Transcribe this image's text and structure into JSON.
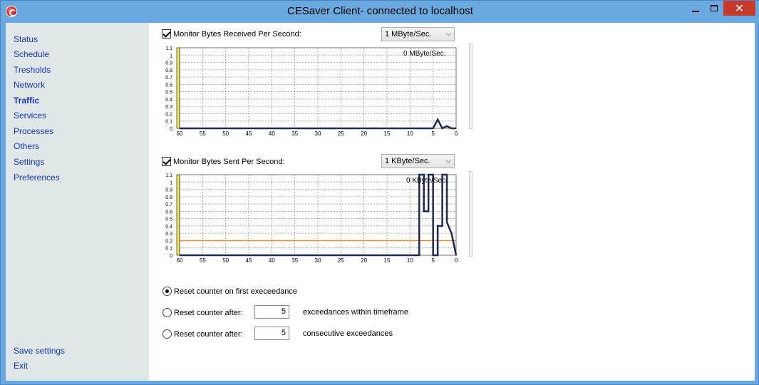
{
  "window": {
    "title": "CESaver Client- connected to localhost"
  },
  "sidebar": {
    "items": [
      {
        "label": "Status"
      },
      {
        "label": "Schedule"
      },
      {
        "label": "Tresholds"
      },
      {
        "label": "Network"
      },
      {
        "label": "Traffic",
        "active": true
      },
      {
        "label": "Services"
      },
      {
        "label": "Processes"
      },
      {
        "label": "Others"
      },
      {
        "label": "Settings"
      },
      {
        "label": "Preferences"
      }
    ],
    "bottom_items": [
      {
        "label": "Save settings"
      },
      {
        "label": "Exit"
      }
    ]
  },
  "received": {
    "checkbox_label": "Monitor Bytes Received Per Second:",
    "checked": true,
    "unit_select": "1 MByte/Sec.",
    "readout": "0 MByte/Sec."
  },
  "sent": {
    "checkbox_label": "Monitor Bytes Sent Per Second:",
    "checked": true,
    "unit_select": "1 KByte/Sec.",
    "readout": "0 KByte/Sec."
  },
  "chart_data": [
    {
      "type": "line",
      "x_ticks": [
        "60",
        "55",
        "50",
        "45",
        "40",
        "35",
        "30",
        "25",
        "20",
        "15",
        "10",
        "5",
        "0"
      ],
      "y_ticks": [
        "0",
        "0.1",
        "0.2",
        "0.3",
        "0.4",
        "0.5",
        "0.6",
        "0.7",
        "0.8",
        "0.9",
        "1",
        "1.1"
      ],
      "xlim": [
        60,
        0
      ],
      "ylim": [
        0,
        1.1
      ],
      "grid": true,
      "x": [
        60,
        10,
        5,
        4,
        3,
        2,
        1,
        0
      ],
      "values": [
        0,
        0,
        0,
        0.12,
        0,
        0.03,
        0,
        0
      ]
    },
    {
      "type": "line",
      "x_ticks": [
        "60",
        "55",
        "50",
        "45",
        "40",
        "35",
        "30",
        "25",
        "20",
        "15",
        "10",
        "5",
        "0"
      ],
      "y_ticks": [
        "0",
        "0.1",
        "0.2",
        "0.3",
        "0.4",
        "0.5",
        "0.6",
        "0.7",
        "0.8",
        "0.9",
        "1",
        "1.1"
      ],
      "xlim": [
        60,
        0
      ],
      "ylim": [
        0,
        1.1
      ],
      "grid": true,
      "threshold": 0.2,
      "colors": {
        "line": "#1c2a55",
        "threshold": "#f08a1c",
        "marker": "#f5e85a"
      },
      "x": [
        60,
        8,
        8,
        7,
        7,
        6,
        6,
        5,
        5,
        4,
        4,
        3,
        3,
        2,
        2,
        1,
        0
      ],
      "values": [
        0,
        0,
        1.1,
        1.1,
        0.6,
        0.6,
        1.1,
        1.1,
        0,
        0,
        0.4,
        0.4,
        1.1,
        1.1,
        0.45,
        0.3,
        0
      ]
    }
  ],
  "reset": {
    "option1": {
      "label": "Reset counter on first execeedance",
      "checked": true
    },
    "option2": {
      "label": "Reset counter after:",
      "checked": false,
      "value": "5",
      "suffix": "exceedances within timeframe"
    },
    "option3": {
      "label": "Reset counter after:",
      "checked": false,
      "value": "5",
      "suffix": "consecutive exceedances"
    }
  }
}
